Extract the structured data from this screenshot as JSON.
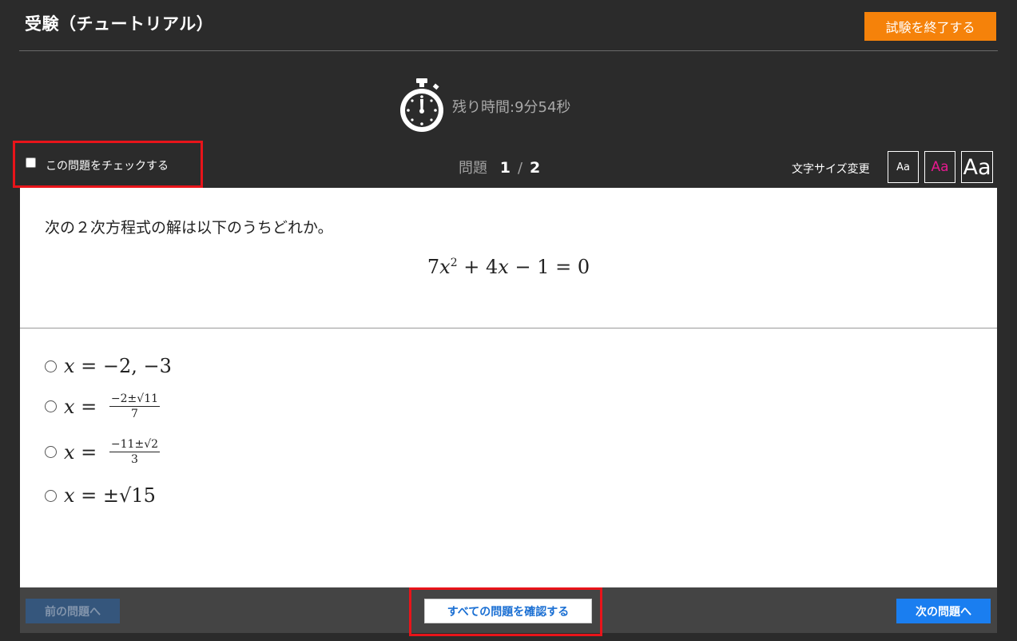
{
  "header": {
    "title": "受験（チュートリアル）",
    "end_exam_label": "試験を終了する"
  },
  "timer": {
    "icon": "stopwatch-icon",
    "text": "残り時間:9分54秒"
  },
  "toolbar": {
    "check_label": "この問題をチェックする",
    "check_checked": false,
    "question_prefix": "問題",
    "question_current": "1",
    "question_separator": "/",
    "question_total": "2",
    "font_size_label": "文字サイズ変更",
    "font_buttons": [
      "Aa",
      "Aa",
      "Aa"
    ]
  },
  "question": {
    "text": "次の２次方程式の解は以下のうちどれか。",
    "equation": {
      "coef_a": "7",
      "var": "x",
      "exp": "2",
      "rest": " + 4",
      "var2": "x",
      "tail": " − 1 = 0"
    }
  },
  "options": [
    {
      "lhs": "x",
      "eq": " = ",
      "rhs": "−2, −3"
    },
    {
      "lhs": "x",
      "eq": " = ",
      "num": "−2±√11",
      "den": "7"
    },
    {
      "lhs": "x",
      "eq": " = ",
      "num": "−11±√2",
      "den": "3"
    },
    {
      "lhs": "x",
      "eq": " = ",
      "rhs": "±√15"
    }
  ],
  "footer": {
    "prev_label": "前の問題へ",
    "review_label": "すべての問題を確認する",
    "next_label": "次の問題へ"
  },
  "colors": {
    "background": "#2b2b2b",
    "end_button": "#f5820a",
    "highlight_border": "#e8141a",
    "next_button": "#1a7ef0",
    "prev_button_disabled": "#35567c",
    "font_mid_accent": "#e8188f"
  }
}
